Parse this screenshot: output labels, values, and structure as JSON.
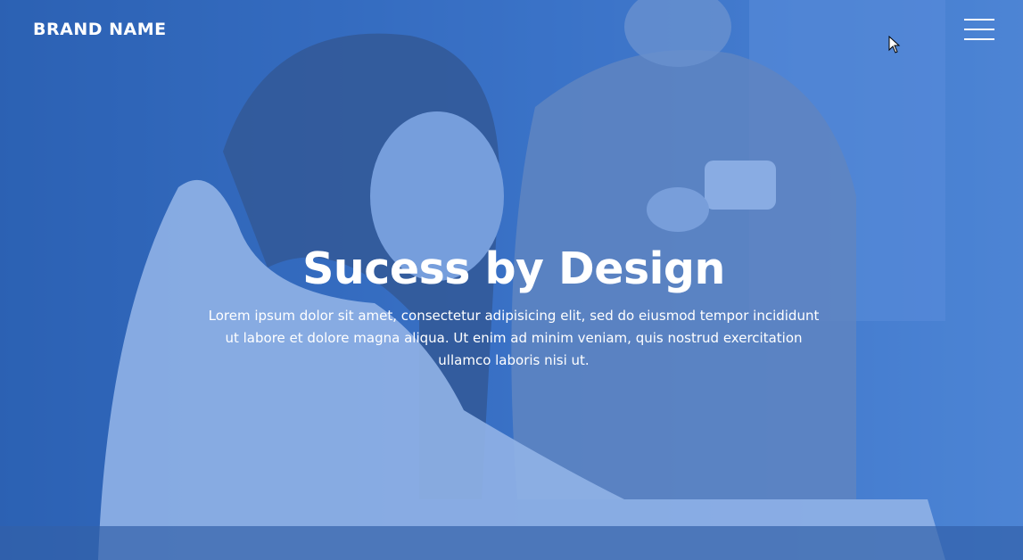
{
  "brand": {
    "name": "BRAND NAME"
  },
  "nav": {
    "menu_icon": "hamburger-menu-icon"
  },
  "hero": {
    "title": "Sucess by Design",
    "text": "Lorem ipsum dolor sit amet, consectetur adipisicing elit, sed do eiusmod tempor incididunt ut labore et dolore magna aliqua. Ut enim ad minim veniam, quis nostrud exercitation ullamco laboris nisi ut.",
    "overlay_color": "#3c78d2"
  },
  "cursor_icon": "mouse-pointer-icon"
}
